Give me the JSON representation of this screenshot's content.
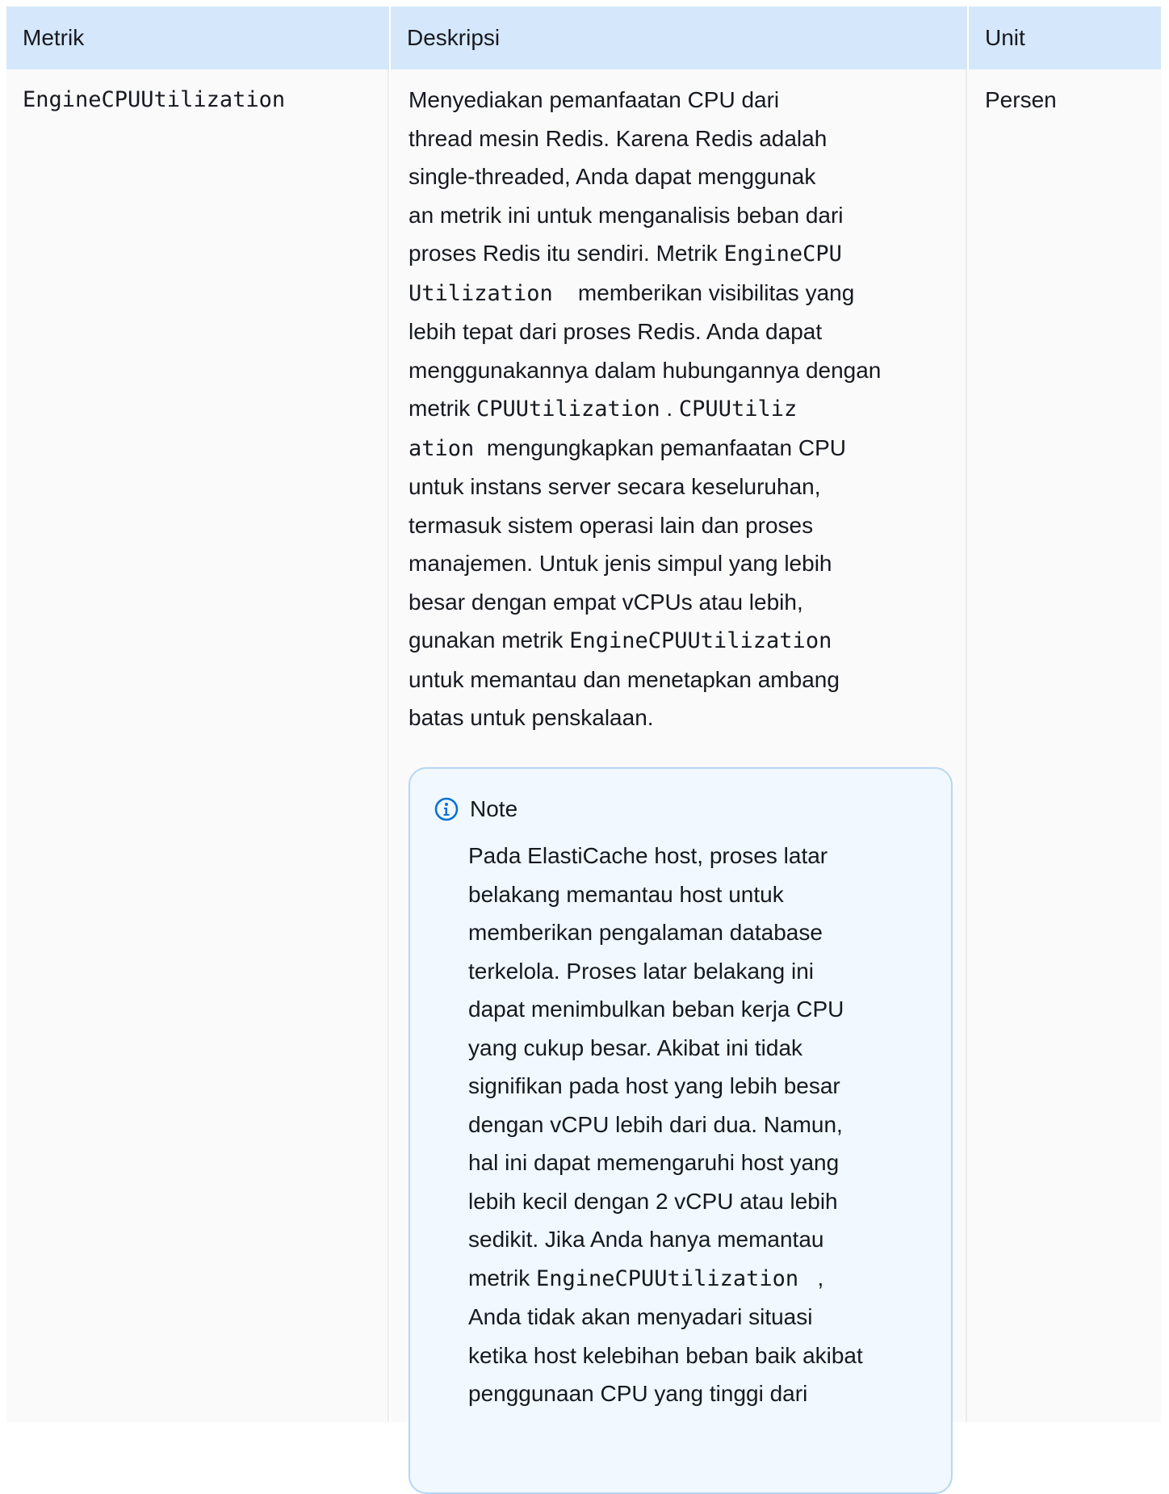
{
  "table": {
    "headers": {
      "metric": "Metrik",
      "description": "Deskripsi",
      "unit": "Unit"
    },
    "row": {
      "metric": "EngineCPUUtilization",
      "unit": "Persen",
      "description": {
        "l01": "Menyediakan pemanfaatan CPU dari",
        "l02": "thread mesin Redis. Karena Redis adalah",
        "l03": "single-threaded, Anda dapat menggunak",
        "l04": "an metrik ini untuk menganalisis beban dari",
        "l05a": "proses Redis itu sendiri. Metrik ",
        "l05b": "EngineCPU",
        "l06a": "Utilization",
        "l06b": "    memberikan visibilitas yang",
        "l07": "lebih tepat dari proses Redis. Anda dapat",
        "l08": "menggunakannya dalam hubungannya dengan",
        "l09a": "metrik ",
        "l09b": "CPUUtilization",
        "l09c": " . ",
        "l09d": "CPUUtiliz",
        "l10a": "ation",
        "l10b": "  mengungkapkan pemanfaatan CPU",
        "l11": "untuk instans server secara keseluruhan,",
        "l12": "termasuk sistem operasi lain dan proses",
        "l13": "manajemen. Untuk jenis simpul yang lebih",
        "l14": "besar dengan empat vCPUs atau lebih,",
        "l15a": "gunakan metrik ",
        "l15b": "EngineCPUUtilization",
        "l16": "untuk memantau dan menetapkan ambang",
        "l17": "batas untuk penskalaan."
      },
      "note": {
        "icon": "info-icon",
        "title": "Note",
        "n01": "Pada ElastiCache host, proses latar",
        "n02": "belakang memantau host untuk",
        "n03": "memberikan pengalaman database",
        "n04": "terkelola. Proses latar belakang ini",
        "n05": "dapat menimbulkan beban kerja CPU",
        "n06": "yang cukup besar. Akibat ini tidak",
        "n07": "signifikan pada host yang lebih besar",
        "n08": "dengan vCPU lebih dari dua. Namun,",
        "n09": "hal ini dapat memengaruhi host yang",
        "n10": "lebih kecil dengan 2 vCPU atau lebih",
        "n11": "sedikit. Jika Anda hanya memantau",
        "n12a": "metrik ",
        "n12b": "EngineCPUUtilization",
        "n12c": "   ,",
        "n13": "Anda tidak akan menyadari situasi",
        "n14": "ketika host kelebihan beban baik akibat",
        "n15": "penggunaan CPU yang tinggi dari"
      }
    },
    "colors": {
      "header_bg": "#d5e7fa",
      "row_bg": "#fafafa",
      "note_bg": "#f1f8ff",
      "note_border": "#b6d6f2",
      "info_icon": "#0972d3"
    }
  }
}
